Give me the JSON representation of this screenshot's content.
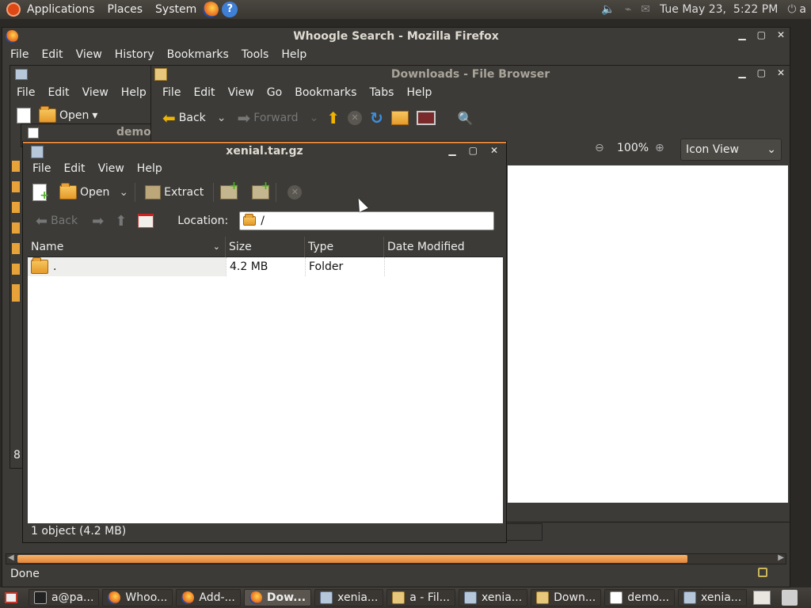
{
  "topbar": {
    "menus": [
      "Applications",
      "Places",
      "System"
    ],
    "datetime": "Tue May 23,  5:22 PM",
    "user": "a"
  },
  "firefox": {
    "title": "Whoogle Search - Mozilla Firefox",
    "menus": [
      "File",
      "Edit",
      "View",
      "History",
      "Bookmarks",
      "Tools",
      "Help"
    ],
    "status": "Done"
  },
  "bg_app": {
    "menus": [
      "File",
      "Edit",
      "View",
      "Help"
    ],
    "open_label": "Open",
    "side_digit": "8"
  },
  "editor_win": {
    "title_fragment": "demo"
  },
  "filebrowser": {
    "title": "Downloads - File Browser",
    "menus": [
      "File",
      "Edit",
      "View",
      "Go",
      "Bookmarks",
      "Tabs",
      "Help"
    ],
    "back_label": "Back",
    "forward_label": "Forward",
    "zoom": "100%",
    "view_mode": "Icon View"
  },
  "archive": {
    "title": "xenial.tar.gz",
    "menus": [
      "File",
      "Edit",
      "View",
      "Help"
    ],
    "open_label": "Open",
    "extract_label": "Extract",
    "back_label": "Back",
    "location_label": "Location:",
    "location_value": "/",
    "columns": [
      "Name",
      "Size",
      "Type",
      "Date Modified"
    ],
    "rows": [
      {
        "name": ".",
        "size": "4.2 MB",
        "type": "Folder",
        "modified": ""
      }
    ],
    "status": "1 object (4.2 MB)"
  },
  "taskbar": {
    "items": [
      {
        "label": "a@pa...",
        "active": false
      },
      {
        "label": "Whoo...",
        "active": false
      },
      {
        "label": "Add-...",
        "active": false
      },
      {
        "label": "Dow...",
        "active": true
      },
      {
        "label": "xenia...",
        "active": false
      },
      {
        "label": "a - Fil...",
        "active": false
      },
      {
        "label": "xenia...",
        "active": false
      },
      {
        "label": "Down...",
        "active": false
      },
      {
        "label": "demo...",
        "active": false
      },
      {
        "label": "xenia...",
        "active": false
      }
    ]
  }
}
